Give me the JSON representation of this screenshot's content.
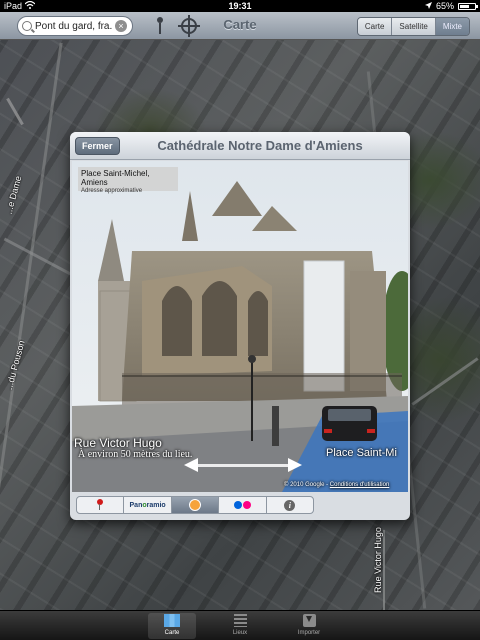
{
  "status_bar": {
    "carrier": "iPad",
    "time": "19:31",
    "battery": "65%",
    "battery_level": 0.65
  },
  "toolbar": {
    "search_value": "Pont du gard, fra...",
    "title": "Carte",
    "map_modes": [
      "Carte",
      "Satellite",
      "Mixte"
    ],
    "selected_mode": "Mixte"
  },
  "map": {
    "road_labels": {
      "left_top": "...e Dame",
      "left_mid": "...du Pouson",
      "bottom": "Rue Victor Hugo"
    }
  },
  "popup": {
    "close_label": "Fermer",
    "title": "Cathédrale Notre Dame d'Amiens",
    "address_line": "Place Saint-Michel, Amiens",
    "address_note": "Adresse approximative",
    "street_left": "Rue Victor Hugo",
    "distance": "À environ 50 mètres du lieu.",
    "street_right": "Place Saint-Mi",
    "copyright": "© 2010 Google",
    "terms": "Conditions d'utilisation",
    "tabs": [
      {
        "name": "pin",
        "icon": "red-pin-icon"
      },
      {
        "name": "Panoramio",
        "label": "Panoramio",
        "icon": "panoramio-logo"
      },
      {
        "name": "street-view",
        "icon": "person-icon",
        "active": true
      },
      {
        "name": "flickr",
        "icon": "flickr-logo"
      },
      {
        "name": "info",
        "icon": "info-icon"
      }
    ]
  },
  "tabbar": {
    "items": [
      {
        "label": "Carte",
        "icon": "map-icon",
        "active": true
      },
      {
        "label": "Lieux",
        "icon": "list-icon",
        "active": false
      },
      {
        "label": "Importer",
        "icon": "import-icon",
        "active": false
      }
    ]
  },
  "colors": {
    "toolbar_gradient_top": "#b9c0c8",
    "selected_segment": "#7f8d9d",
    "popup_title": "#5b6470",
    "flickr_blue": "#0063dc",
    "flickr_pink": "#ff0084",
    "street_view_orange": "#f6a33a"
  }
}
